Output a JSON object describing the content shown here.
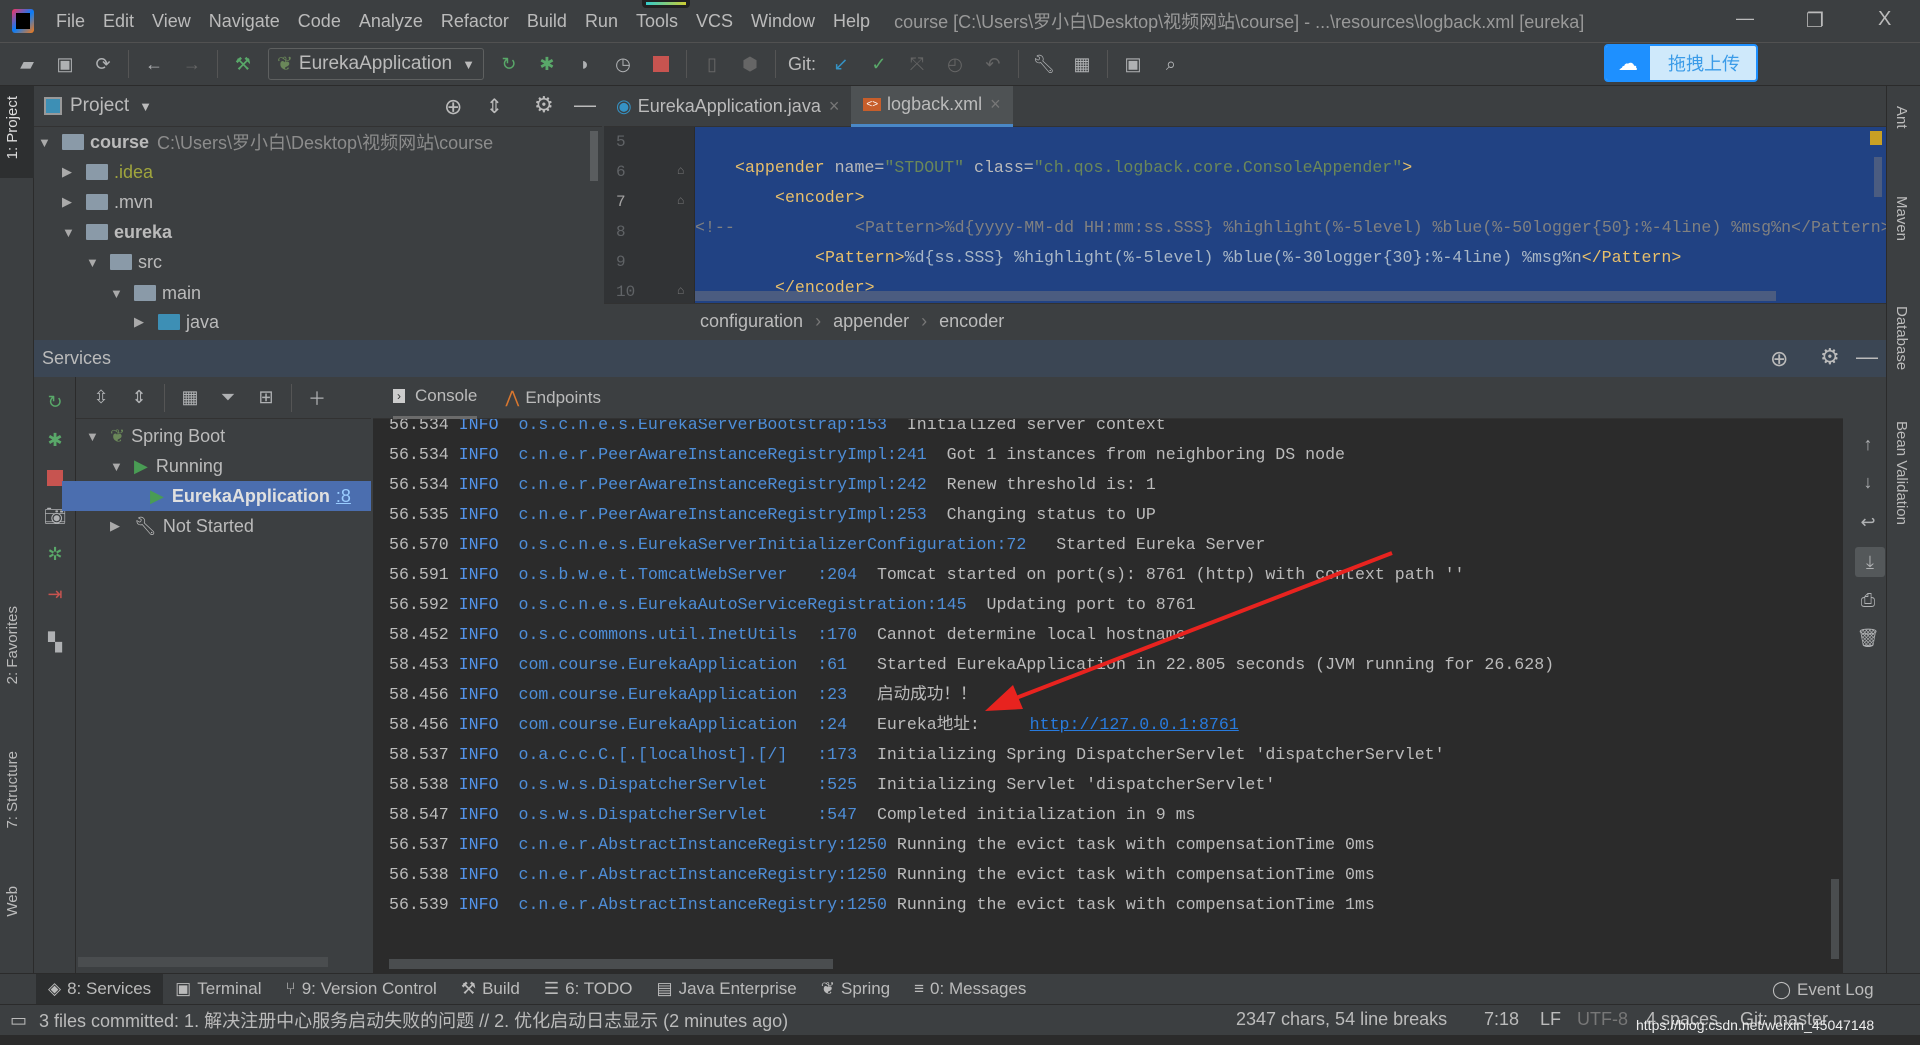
{
  "window": {
    "title": "course [C:\\Users\\罗小白\\Desktop\\视频网站\\course] - ...\\resources\\logback.xml [eureka]",
    "minimize": "—",
    "restore": "❐",
    "close": "X"
  },
  "menu": [
    {
      "label": "File",
      "u": "F"
    },
    {
      "label": "Edit",
      "u": "E"
    },
    {
      "label": "View",
      "u": "V"
    },
    {
      "label": "Navigate",
      "u": "N"
    },
    {
      "label": "Code",
      "u": "C"
    },
    {
      "label": "Analyze",
      "u": ""
    },
    {
      "label": "Refactor",
      "u": "R"
    },
    {
      "label": "Build",
      "u": "B"
    },
    {
      "label": "Run",
      "u": ""
    },
    {
      "label": "Tools",
      "u": "T"
    },
    {
      "label": "VCS",
      "u": ""
    },
    {
      "label": "Window",
      "u": "W"
    },
    {
      "label": "Help",
      "u": "H"
    }
  ],
  "toolbar": {
    "run_config": "EurekaApplication",
    "git_label": "Git:",
    "upload_button": "拖拽上传"
  },
  "left_stripe": {
    "project": "1: Project",
    "favorites": "2: Favorites",
    "structure": "7: Structure",
    "web": "Web"
  },
  "right_stripe": {
    "ant": "Ant",
    "maven": "Maven",
    "database": "Database",
    "bean": "Bean Validation"
  },
  "project": {
    "title": "Project",
    "tree": [
      {
        "name": "course",
        "path": "C:\\Users\\罗小白\\Desktop\\视频网站\\course"
      },
      {
        "name": ".idea"
      },
      {
        "name": ".mvn"
      },
      {
        "name": "eureka"
      },
      {
        "name": "src"
      },
      {
        "name": "main"
      },
      {
        "name": "java"
      }
    ]
  },
  "editor": {
    "tabs": [
      {
        "label": "EurekaApplication.java",
        "close": "×"
      },
      {
        "label": "logback.xml",
        "close": "×"
      }
    ],
    "line_numbers": [
      "5",
      "6",
      "7",
      "8",
      "9",
      "10"
    ],
    "lines": {
      "l6": [
        "<appender ",
        "name=",
        "\"STDOUT\"",
        " class=",
        "\"ch.qos.logback.core.ConsoleAppender\"",
        ">"
      ],
      "l7": "<encoder>",
      "l8_comment": "<!--",
      "l8": "<Pattern>%d{yyyy-MM-dd HH:mm:ss.SSS} %highlight(%-5level) %blue(%-50logger{50}:%-4line) %msg%n</Pattern>",
      "l9": [
        "<Pattern>",
        "%d{ss.SSS} %highlight(%-5level) %blue(%-30logger{30}:%-4line) %msg%n",
        "</Pattern>"
      ],
      "l10": "</encoder>"
    },
    "breadcrumb": [
      "configuration",
      "appender",
      "encoder"
    ]
  },
  "services": {
    "title": "Services",
    "tree": {
      "spring_boot": "Spring Boot",
      "running": "Running",
      "app": "EurekaApplication",
      "app_suffix": ":8",
      "not_started": "Not Started"
    },
    "console_tabs": [
      "Console",
      "Endpoints"
    ],
    "log": [
      {
        "t": "56.534",
        "l": "INFO ",
        "g": "o.s.c.n.e.s.EurekaServerBootstrap:153 ",
        "m": " Initialized server context"
      },
      {
        "t": "56.534",
        "l": "INFO ",
        "g": "c.n.e.r.PeerAwareInstanceRegistryImpl:241 ",
        "m": " Got 1 instances from neighboring DS node"
      },
      {
        "t": "56.534",
        "l": "INFO ",
        "g": "c.n.e.r.PeerAwareInstanceRegistryImpl:242 ",
        "m": " Renew threshold is: 1"
      },
      {
        "t": "56.535",
        "l": "INFO ",
        "g": "c.n.e.r.PeerAwareInstanceRegistryImpl:253 ",
        "m": " Changing status to UP"
      },
      {
        "t": "56.570",
        "l": "INFO ",
        "g": "o.s.c.n.e.s.EurekaServerInitializerConfiguration:72  ",
        "m": " Started Eureka Server"
      },
      {
        "t": "56.591",
        "l": "INFO ",
        "g": "o.s.b.w.e.t.TomcatWebServer   :204 ",
        "m": " Tomcat started on port(s): 8761 (http) with context path ''"
      },
      {
        "t": "56.592",
        "l": "INFO ",
        "g": "o.s.c.n.e.s.EurekaAutoServiceRegistration:145 ",
        "m": " Updating port to 8761"
      },
      {
        "t": "58.452",
        "l": "INFO ",
        "g": "o.s.c.commons.util.InetUtils  :170 ",
        "m": " Cannot determine local hostname"
      },
      {
        "t": "58.453",
        "l": "INFO ",
        "g": "com.course.EurekaApplication  :61  ",
        "m": " Started EurekaApplication in 22.805 seconds (JVM running for 26.628)"
      },
      {
        "t": "58.456",
        "l": "INFO ",
        "g": "com.course.EurekaApplication  :23  ",
        "m": " 启动成功！！"
      },
      {
        "t": "58.456",
        "l": "INFO ",
        "g": "com.course.EurekaApplication  :24  ",
        "m": " Eureka地址:     ",
        "link": "http://127.0.0.1:8761"
      },
      {
        "t": "58.537",
        "l": "INFO ",
        "g": "o.a.c.c.C.[.[localhost].[/]   :173 ",
        "m": " Initializing Spring DispatcherServlet 'dispatcherServlet'"
      },
      {
        "t": "58.538",
        "l": "INFO ",
        "g": "o.s.w.s.DispatcherServlet     :525 ",
        "m": " Initializing Servlet 'dispatcherServlet'"
      },
      {
        "t": "58.547",
        "l": "INFO ",
        "g": "o.s.w.s.DispatcherServlet     :547 ",
        "m": " Completed initialization in 9 ms"
      },
      {
        "t": "56.537",
        "l": "INFO ",
        "g": "c.n.e.r.AbstractInstanceRegistry:1250",
        "m": " Running the evict task with compensationTime 0ms"
      },
      {
        "t": "56.538",
        "l": "INFO ",
        "g": "c.n.e.r.AbstractInstanceRegistry:1250",
        "m": " Running the evict task with compensationTime 0ms"
      },
      {
        "t": "56.539",
        "l": "INFO ",
        "g": "c.n.e.r.AbstractInstanceRegistry:1250",
        "m": " Running the evict task with compensationTime 1ms"
      }
    ]
  },
  "bottom_tabs": [
    "8: Services",
    "Terminal",
    "9: Version Control",
    "Build",
    "6: TODO",
    "Java Enterprise",
    "Spring",
    "0: Messages"
  ],
  "event_log": "Event Log",
  "status": {
    "message": "3 files committed: 1. 解决注册中心服务启动失败的问题 // 2. 优化启动日志显示 (2 minutes ago)",
    "chars": "2347 chars, 54 line breaks",
    "pos": "7:18",
    "eol": "LF",
    "encoding": "UTF-8",
    "indent": "4 spaces",
    "branch": "Git: master",
    "watermark": "https://blog.csdn.net/weixin_45047148"
  },
  "colors": {
    "accent": "#4b6eaf",
    "selection": "#214283",
    "annotation_arrow": "#e8231f",
    "upload": "#1e90ff"
  }
}
